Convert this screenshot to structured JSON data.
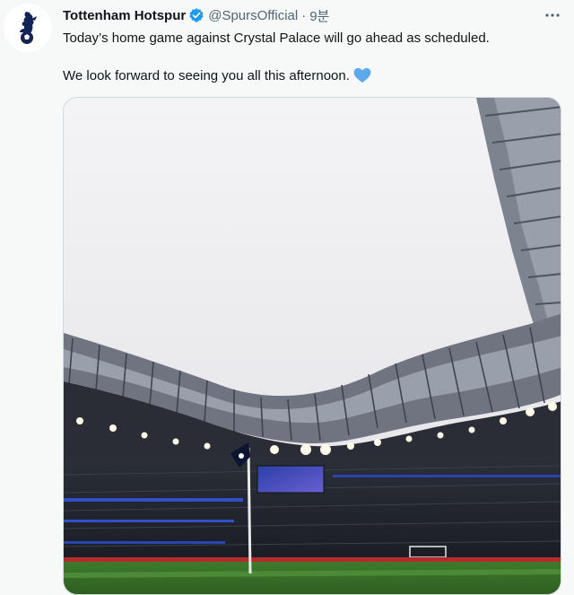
{
  "tweet": {
    "display_name": "Tottenham Hotspur",
    "handle": "@SpursOfficial",
    "separator": "·",
    "time": "9분",
    "more_label": "···",
    "line1": "Today’s home game against Crystal Palace will go ahead as scheduled.",
    "line2": "We look forward to seeing you all this afternoon.",
    "heart_emoji": "blue-heart-icon",
    "verified_icon": "verified-badge-icon",
    "avatar_icon": "spurs-crest-icon",
    "media_icon": "stadium-photo"
  },
  "colors": {
    "text": "#0f1419",
    "secondary": "#536471",
    "verified": "#1d9bf0",
    "heart": "#5da9e9",
    "background": "#f7f9f9"
  }
}
